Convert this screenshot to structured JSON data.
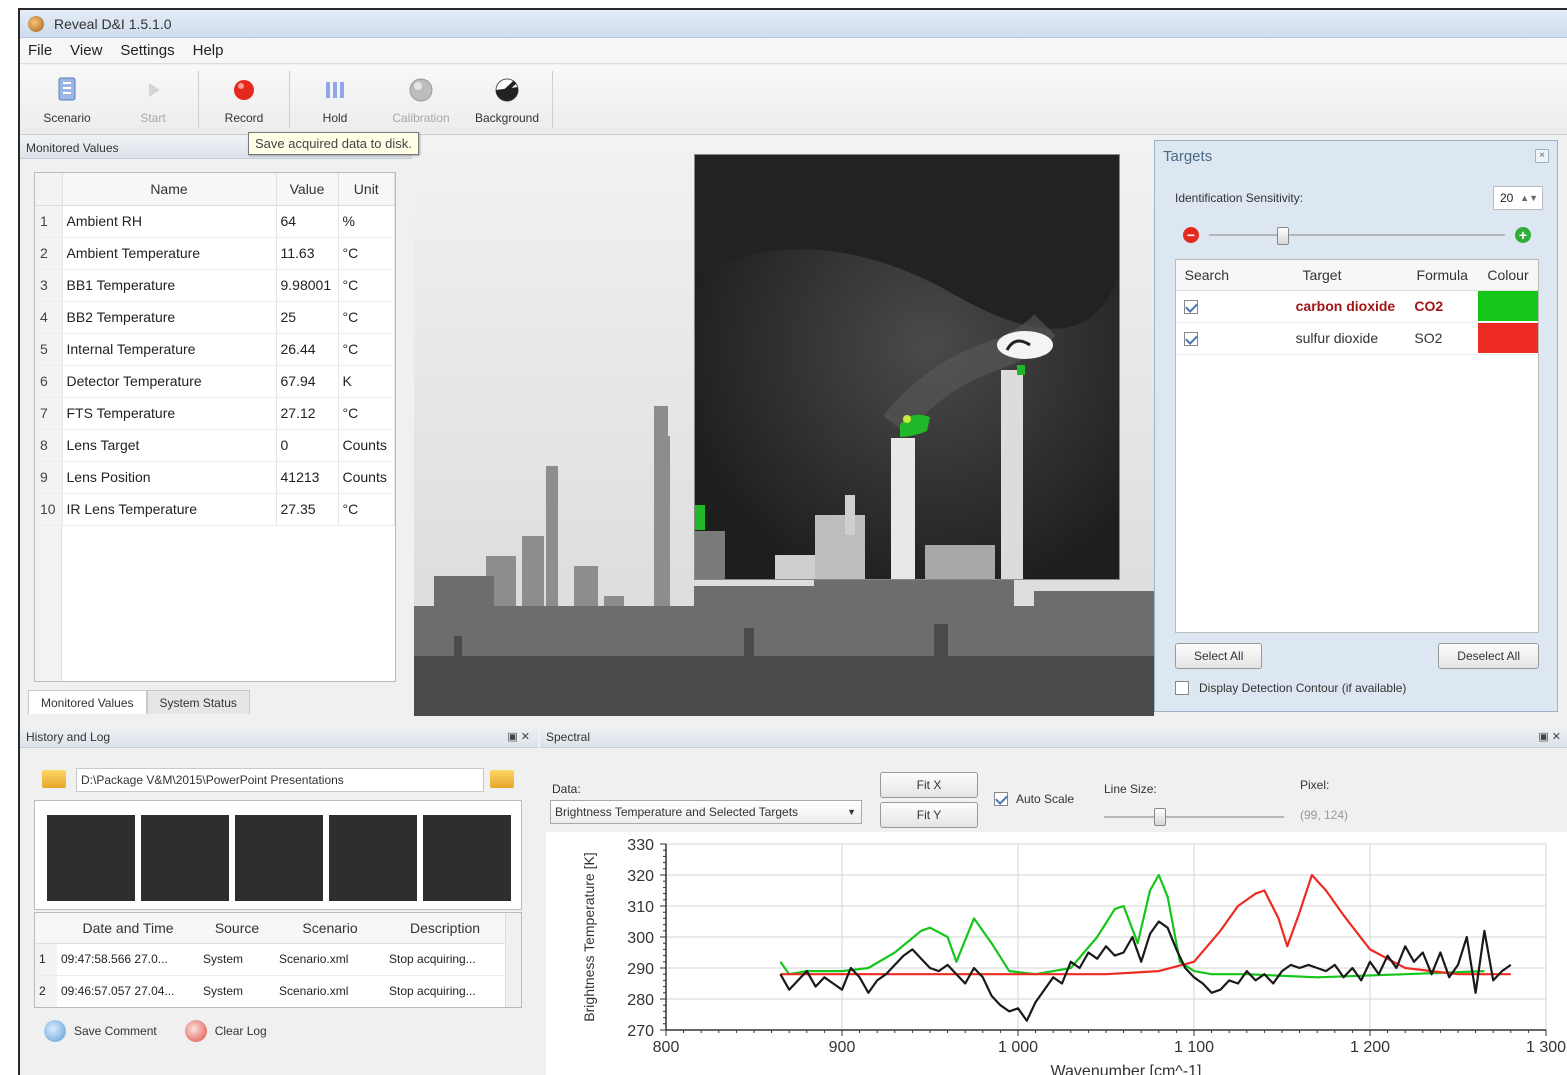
{
  "window": {
    "title": "Reveal D&I 1.5.1.0"
  },
  "menu": [
    "File",
    "View",
    "Settings",
    "Help"
  ],
  "toolbar": {
    "scenario": "Scenario",
    "start": "Start",
    "record": "Record",
    "hold": "Hold",
    "calibration": "Calibration",
    "background": "Background",
    "tooltip": "Save acquired data to disk."
  },
  "monitored": {
    "title": "Monitored Values",
    "columns": [
      "Name",
      "Value",
      "Unit"
    ],
    "rows": [
      {
        "i": "1",
        "name": "Ambient RH",
        "value": "64",
        "unit": "%"
      },
      {
        "i": "2",
        "name": "Ambient Temperature",
        "value": "11.63",
        "unit": "°C"
      },
      {
        "i": "3",
        "name": "BB1 Temperature",
        "value": "9.98001",
        "unit": "°C"
      },
      {
        "i": "4",
        "name": "BB2 Temperature",
        "value": "25",
        "unit": "°C"
      },
      {
        "i": "5",
        "name": "Internal Temperature",
        "value": "26.44",
        "unit": "°C"
      },
      {
        "i": "6",
        "name": "Detector Temperature",
        "value": "67.94",
        "unit": "K"
      },
      {
        "i": "7",
        "name": "FTS Temperature",
        "value": "27.12",
        "unit": "°C"
      },
      {
        "i": "8",
        "name": "Lens Target",
        "value": "0",
        "unit": "Counts"
      },
      {
        "i": "9",
        "name": "Lens Position",
        "value": "41213",
        "unit": "Counts"
      },
      {
        "i": "10",
        "name": "IR Lens Temperature",
        "value": "27.35",
        "unit": "°C"
      }
    ],
    "tabs": [
      "Monitored Values",
      "System Status"
    ]
  },
  "targets": {
    "title": "Targets",
    "sensitivity_label": "Identification Sensitivity:",
    "sensitivity_value": "20",
    "sensitivity_level": 0.24,
    "columns": [
      "Search",
      "Target",
      "Formula",
      "Colour"
    ],
    "rows": [
      {
        "checked": true,
        "target": "carbon dioxide",
        "formula": "CO2",
        "colour": "#16c51a",
        "highlight": true
      },
      {
        "checked": true,
        "target": "sulfur dioxide",
        "formula": "SO2",
        "colour": "#ee2b22",
        "highlight": false
      }
    ],
    "select_all": "Select All",
    "deselect_all": "Deselect All",
    "contour_label": "Display Detection Contour (if available)"
  },
  "history": {
    "title": "History and Log",
    "path": "D:\\Package V&M\\2015\\PowerPoint Presentations",
    "columns": [
      "Date and Time",
      "Source",
      "Scenario",
      "Description"
    ],
    "rows": [
      {
        "i": "1",
        "datetime": "09:47:58.566 27.0...",
        "source": "System",
        "scenario": "Scenario.xml",
        "description": "Stop acquiring..."
      },
      {
        "i": "2",
        "datetime": "09:46:57.057 27.04...",
        "source": "System",
        "scenario": "Scenario.xml",
        "description": "Stop acquiring..."
      }
    ],
    "save_comment": "Save Comment",
    "clear_log": "Clear Log"
  },
  "spectral": {
    "title": "Spectral",
    "data_label": "Data:",
    "data_value": "Brightness Temperature and Selected Targets",
    "fit_x": "Fit X",
    "fit_y": "Fit Y",
    "auto_scale": "Auto Scale",
    "line_size_label": "Line Size:",
    "line_size_level": 0.3,
    "pixel_label": "Pixel:",
    "pixel_value": "(99, 124)"
  },
  "colors": {
    "co2": "#16c51a",
    "so2": "#ee2b22",
    "measured": "#1a1a1a",
    "accent_blue": "#4a6b8c"
  },
  "chart_data": {
    "type": "line",
    "xlabel": "Wavenumber [cm^-1]",
    "ylabel": "Brightness Temperature [K]",
    "xlim": [
      800,
      1300
    ],
    "ylim": [
      270,
      330
    ],
    "xticks": [
      "800",
      "900",
      "1 000",
      "1 100",
      "1 200",
      "1 300"
    ],
    "yticks": [
      "270",
      "280",
      "290",
      "300",
      "310",
      "320",
      "330"
    ],
    "grid": true,
    "series": [
      {
        "color": "#16c51a",
        "x": [
          865,
          870,
          880,
          900,
          915,
          930,
          945,
          950,
          960,
          965,
          975,
          985,
          995,
          1010,
          1030,
          1045,
          1055,
          1060,
          1068,
          1075,
          1080,
          1085,
          1092,
          1100,
          1110,
          1130,
          1170,
          1220,
          1265
        ],
        "y": [
          292,
          288,
          289,
          289,
          290,
          295,
          302,
          303,
          300,
          292,
          306,
          298,
          289,
          288,
          290,
          300,
          309,
          310,
          298,
          315,
          320,
          313,
          292,
          289,
          288,
          288,
          287,
          288,
          289
        ]
      },
      {
        "color": "#ee2b22",
        "x": [
          865,
          900,
          950,
          1000,
          1050,
          1080,
          1100,
          1115,
          1125,
          1135,
          1140,
          1148,
          1153,
          1160,
          1167,
          1175,
          1185,
          1200,
          1220,
          1250,
          1280
        ],
        "y": [
          288,
          288,
          288,
          288,
          288,
          289,
          292,
          302,
          310,
          314,
          315,
          306,
          297,
          308,
          320,
          315,
          307,
          296,
          290,
          288,
          288
        ]
      },
      {
        "color": "#1a1a1a",
        "x": [
          865,
          870,
          875,
          880,
          885,
          890,
          895,
          900,
          905,
          910,
          915,
          920,
          925,
          930,
          935,
          940,
          945,
          950,
          955,
          960,
          965,
          970,
          975,
          980,
          985,
          990,
          995,
          1000,
          1005,
          1010,
          1015,
          1020,
          1025,
          1030,
          1035,
          1040,
          1045,
          1050,
          1055,
          1060,
          1065,
          1070,
          1075,
          1080,
          1085,
          1090,
          1095,
          1100,
          1105,
          1110,
          1115,
          1120,
          1125,
          1130,
          1135,
          1140,
          1145,
          1150,
          1155,
          1160,
          1165,
          1170,
          1175,
          1180,
          1185,
          1190,
          1195,
          1200,
          1205,
          1210,
          1215,
          1220,
          1225,
          1230,
          1235,
          1240,
          1245,
          1250,
          1255,
          1260,
          1265,
          1270,
          1275,
          1280
        ],
        "y": [
          288,
          283,
          286,
          289,
          284,
          287,
          285,
          283,
          290,
          287,
          282,
          286,
          288,
          291,
          294,
          296,
          293,
          290,
          289,
          291,
          288,
          285,
          290,
          287,
          281,
          278,
          276,
          277,
          273,
          279,
          283,
          287,
          285,
          292,
          290,
          295,
          293,
          297,
          294,
          295,
          300,
          292,
          301,
          305,
          303,
          296,
          290,
          287,
          285,
          282,
          283,
          286,
          285,
          289,
          286,
          288,
          285,
          289,
          291,
          290,
          291,
          290,
          289,
          291,
          287,
          290,
          286,
          292,
          288,
          294,
          290,
          297,
          292,
          295,
          288,
          295,
          287,
          291,
          300,
          282,
          302,
          286,
          289,
          291
        ]
      }
    ]
  }
}
